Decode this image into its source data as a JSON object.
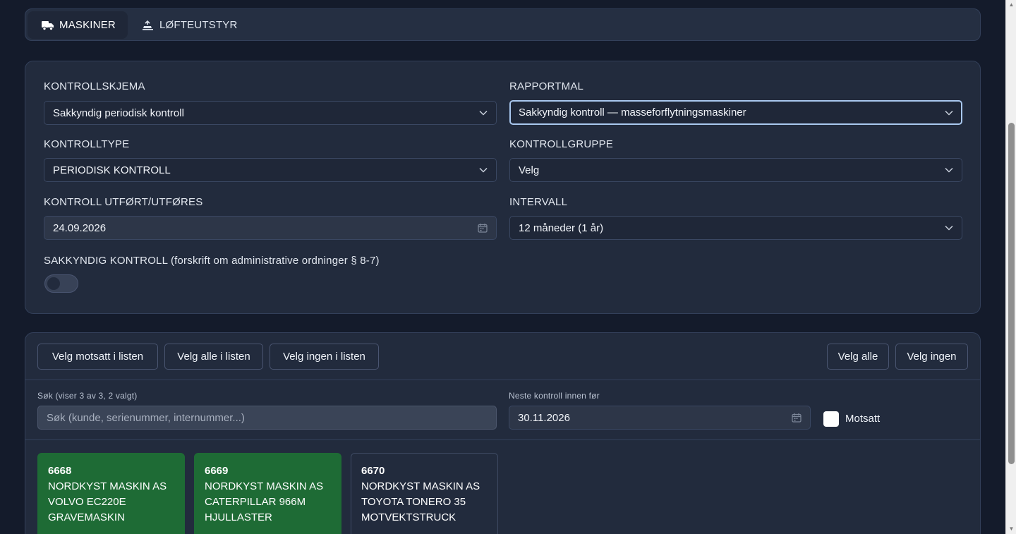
{
  "tabs": [
    {
      "label": "MASKINER",
      "icon": "truck-icon",
      "active": true
    },
    {
      "label": "LØFTEUTSTYR",
      "icon": "lifting-icon",
      "active": false
    }
  ],
  "form": {
    "kontrollskjema": {
      "label": "KONTROLLSKJEMA",
      "value": "Sakkyndig periodisk kontroll"
    },
    "rapportmal": {
      "label": "RAPPORTMAL",
      "value": "Sakkyndig kontroll — masseforflytningsmaskiner"
    },
    "kontrolltype": {
      "label": "KONTROLLTYPE",
      "value": "PERIODISK KONTROLL"
    },
    "kontrollgruppe": {
      "label": "KONTROLLGRUPPE",
      "value": "Velg"
    },
    "kontroll_utfort": {
      "label": "KONTROLL UTFØRT/UTFØRES",
      "value": "24.09.2026"
    },
    "intervall": {
      "label": "INTERVALL",
      "value": "12 måneder (1 år)"
    },
    "sakkyndig": {
      "label": "SAKKYNDIG KONTROLL (forskrift om administrative ordninger § 8-7)",
      "enabled": false
    }
  },
  "list": {
    "buttons": {
      "velg_motsatt": "Velg motsatt i listen",
      "velg_alle_listen": "Velg alle i listen",
      "velg_ingen_listen": "Velg ingen i listen",
      "velg_alle": "Velg alle",
      "velg_ingen": "Velg ingen"
    },
    "search": {
      "label": "Søk (viser 3 av 3, 2 valgt)",
      "placeholder": "Søk (kunde, serienummer, internummer...)",
      "value": ""
    },
    "neste": {
      "label": "Neste kontroll innen før",
      "value": "30.11.2026"
    },
    "motsatt": {
      "label": "Motsatt",
      "checked": false
    },
    "items": [
      {
        "number": "6668",
        "customer": "NORDKYST MASKIN AS",
        "model": "VOLVO EC220E",
        "type": "GRAVEMASKIN",
        "selected": true
      },
      {
        "number": "6669",
        "customer": "NORDKYST MASKIN AS",
        "model": "CATERPILLAR 966M",
        "type": "HJULLASTER",
        "selected": true
      },
      {
        "number": "6670",
        "customer": "NORDKYST MASKIN AS",
        "model": "TOYOTA TONERO 35",
        "type": "MOTVEKTSTRUCK",
        "selected": false
      }
    ]
  },
  "colors": {
    "background": "#141b2b",
    "card": "#222b3d",
    "selected_item": "#1e6b35",
    "focus_border": "#a9c8ef"
  }
}
